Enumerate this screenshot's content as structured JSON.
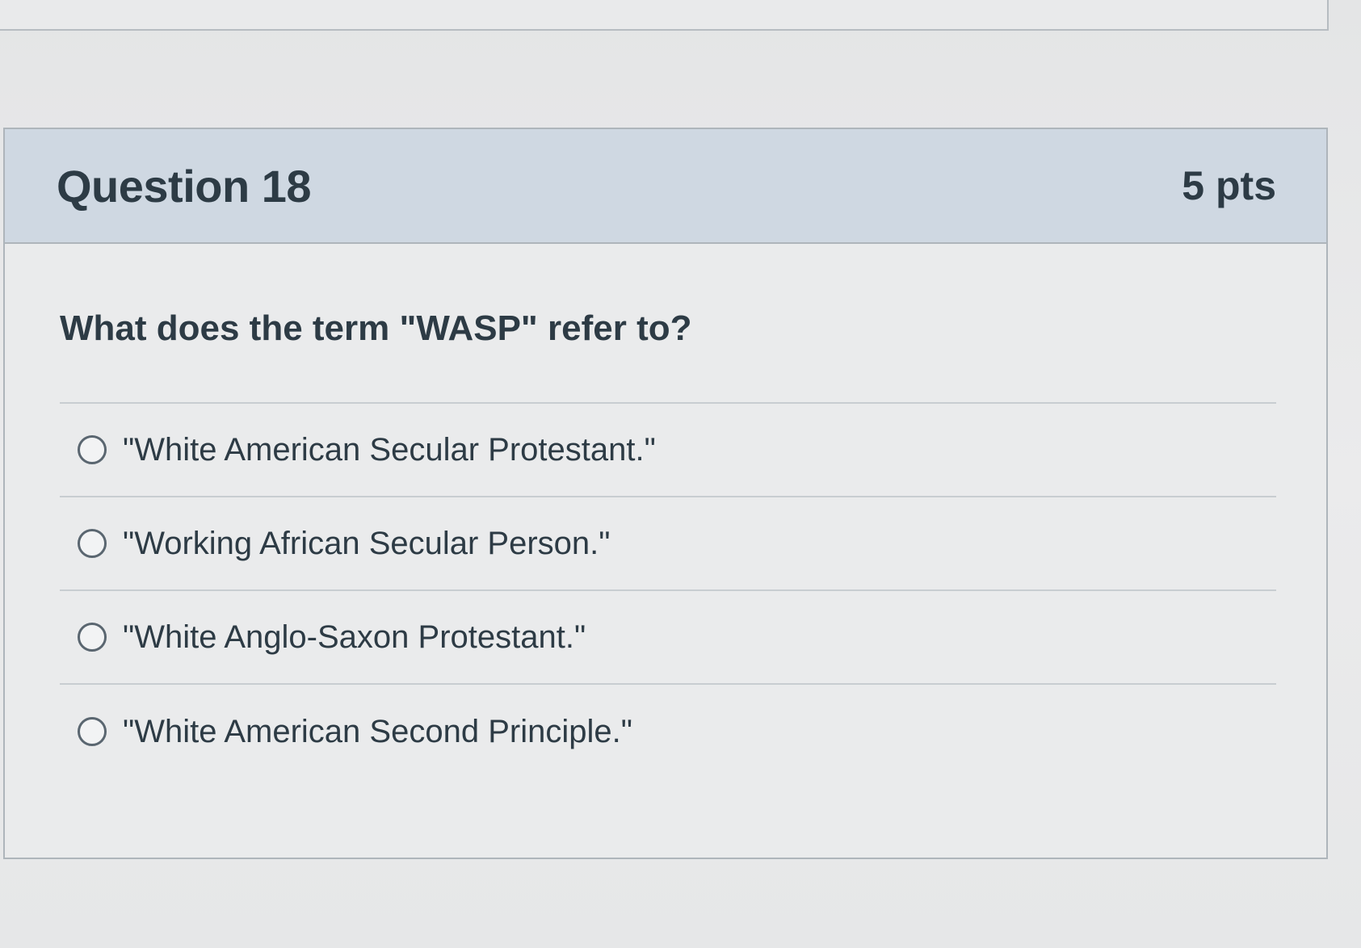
{
  "question": {
    "title": "Question 18",
    "points": "5 pts",
    "text": "What does the term \"WASP\" refer to?",
    "answers": [
      {
        "label": "\"White American Secular Protestant.\"",
        "selected": false
      },
      {
        "label": "\"Working African Secular Person.\"",
        "selected": false
      },
      {
        "label": "\"White Anglo-Saxon Protestant.\"",
        "selected": false
      },
      {
        "label": "\"White American Second Principle.\"",
        "selected": false
      }
    ]
  },
  "colors": {
    "header_bg": "#cfd8e2",
    "text": "#2d3b45",
    "border": "#aeb5bb"
  }
}
